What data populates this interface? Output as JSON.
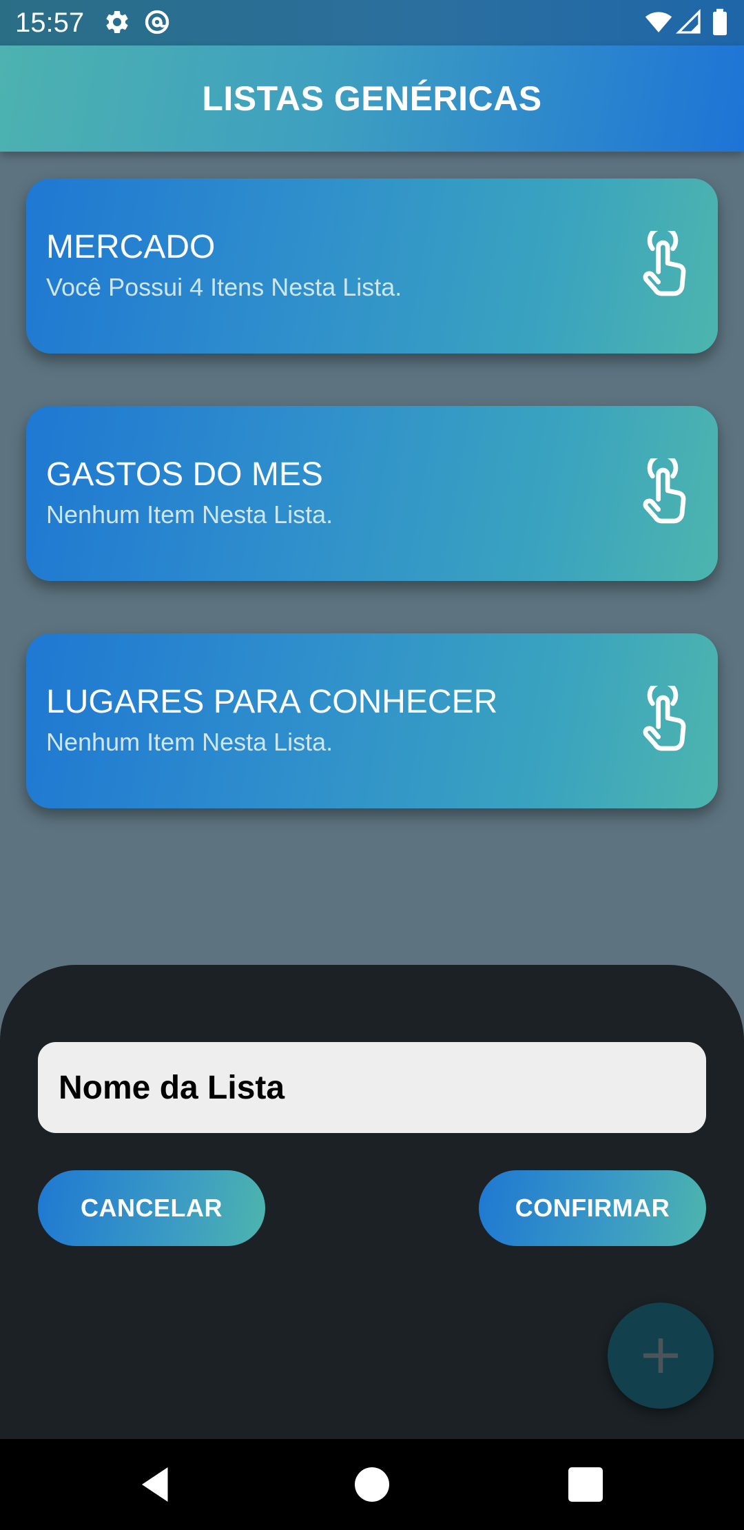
{
  "status_bar": {
    "time": "15:57",
    "icons": [
      "gear-icon",
      "at-sign-icon",
      "wifi-icon",
      "signal-icon",
      "battery-icon"
    ]
  },
  "app_bar": {
    "title": "LISTAS GENÉRICAS"
  },
  "lists": [
    {
      "title": "MERCADO",
      "subtitle": "Você Possui 4 Itens Nesta Lista.",
      "icon": "tap-hand-icon"
    },
    {
      "title": "GASTOS DO MES",
      "subtitle": "Nenhum Item Nesta Lista.",
      "icon": "tap-hand-icon"
    },
    {
      "title": "LUGARES PARA CONHECER",
      "subtitle": "Nenhum Item Nesta Lista.",
      "icon": "tap-hand-icon"
    }
  ],
  "bottom_sheet": {
    "input_value": "Nome da Lista",
    "cancel_label": "CANCELAR",
    "confirm_label": "CONFIRMAR"
  },
  "fab": {
    "icon": "plus-icon"
  },
  "nav_bar": {
    "icons": [
      "back-icon",
      "home-icon",
      "recents-icon"
    ]
  },
  "colors": {
    "app_bar_start": "#4db2b0",
    "app_bar_end": "#1e74d6",
    "card_start": "#1f78d2",
    "card_end": "#4db5ad",
    "sheet_background": "#1b2125",
    "input_background": "#eeeeee",
    "scrim": "#5d7480"
  }
}
